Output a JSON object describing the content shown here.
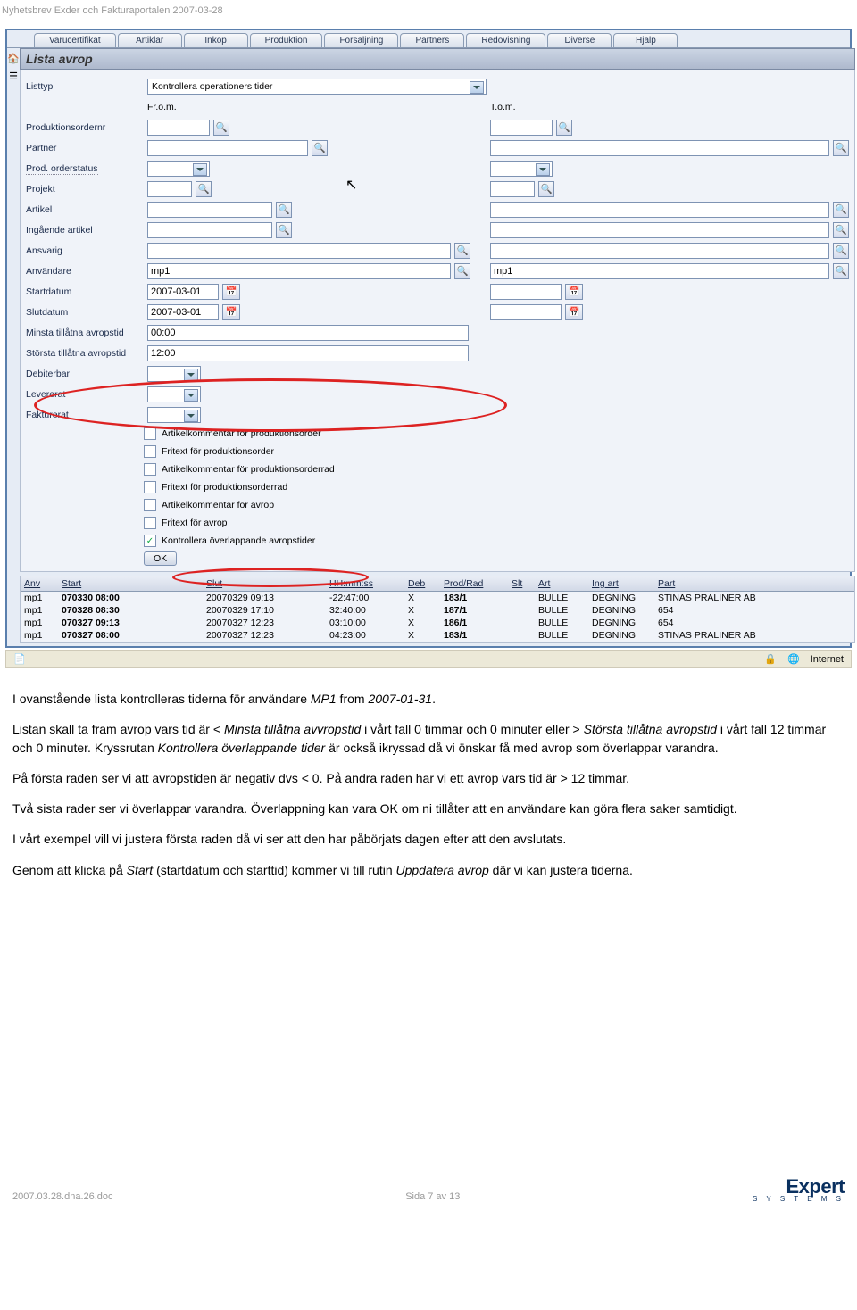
{
  "page_header": "Nyhetsbrev Exder och Fakturaportalen 2007-03-28",
  "menu": [
    "Varucertifikat",
    "Artiklar",
    "Inköp",
    "Produktion",
    "Försäljning",
    "Partners",
    "Redovisning",
    "Diverse",
    "Hjälp"
  ],
  "panel_title": "Lista avrop",
  "labels": {
    "listtyp": "Listtyp",
    "from": "Fr.o.m.",
    "tom": "T.o.m.",
    "podnr": "Produktionsordernr",
    "partner": "Partner",
    "status": "Prod. orderstatus",
    "projekt": "Projekt",
    "artikel": "Artikel",
    "ingart": "Ingående artikel",
    "ansvarig": "Ansvarig",
    "anvandare": "Användare",
    "startdatum": "Startdatum",
    "slutdatum": "Slutdatum",
    "mintid": "Minsta tillåtna avropstid",
    "maxtid": "Största tillåtna avropstid",
    "debiterbar": "Debiterbar",
    "levererat": "Levererat",
    "fakturerat": "Fakturerat"
  },
  "values": {
    "listtyp": "Kontrollera operationers tider",
    "anv_from": "mp1",
    "anv_to": "mp1",
    "startdatum": "2007-03-01",
    "slutdatum": "2007-03-01",
    "mintid": "00:00",
    "maxtid": "12:00"
  },
  "checkboxes": [
    {
      "label": "Artikelkommentar för produktionsorder",
      "checked": false
    },
    {
      "label": "Fritext för produktionsorder",
      "checked": false
    },
    {
      "label": "Artikelkommentar för produktionsorderrad",
      "checked": false
    },
    {
      "label": "Fritext för produktionsorderrad",
      "checked": false
    },
    {
      "label": "Artikelkommentar för avrop",
      "checked": false
    },
    {
      "label": "Fritext för avrop",
      "checked": false
    },
    {
      "label": "Kontrollera överlappande avropstider",
      "checked": true
    }
  ],
  "ok_label": "OK",
  "table": {
    "headers": {
      "anv": "Anv",
      "start": "Start",
      "slut": "Slut",
      "hms": "HH:mm:ss",
      "deb": "Deb",
      "prad": "Prod/Rad",
      "slt": "Slt",
      "art": "Art",
      "ing": "Ing art",
      "part": "Part"
    },
    "rows": [
      {
        "anv": "mp1",
        "start": "070330 08:00",
        "slut": "20070329 09:13",
        "hms": "-22:47:00",
        "deb": "X",
        "prad": "183/1",
        "slt": "",
        "art": "BULLE",
        "ing": "DEGNING",
        "part": "STINAS PRALINER AB"
      },
      {
        "anv": "mp1",
        "start": "070328 08:30",
        "slut": "20070329 17:10",
        "hms": "32:40:00",
        "deb": "X",
        "prad": "187/1",
        "slt": "",
        "art": "BULLE",
        "ing": "DEGNING",
        "part": "654"
      },
      {
        "anv": "mp1",
        "start": "070327 09:13",
        "slut": "20070327 12:23",
        "hms": "03:10:00",
        "deb": "X",
        "prad": "186/1",
        "slt": "",
        "art": "BULLE",
        "ing": "DEGNING",
        "part": "654"
      },
      {
        "anv": "mp1",
        "start": "070327 08:00",
        "slut": "20070327 12:23",
        "hms": "04:23:00",
        "deb": "X",
        "prad": "183/1",
        "slt": "",
        "art": "BULLE",
        "ing": "DEGNING",
        "part": "STINAS PRALINER AB"
      }
    ]
  },
  "status": {
    "zone": "Internet"
  },
  "paragraphs": {
    "p1a": "I ovanstående lista kontrolleras tiderna för användare ",
    "p1b": "MP1",
    "p1c": " from ",
    "p1d": "2007-01-31",
    "p1e": ".",
    "p2a": "Listan skall ta fram avrop vars tid är < ",
    "p2b": "Minsta tillåtna avvropstid",
    "p2c": " i vårt fall 0 timmar och 0 minuter eller > ",
    "p2d": "Största tillåtna avropstid",
    "p2e": " i vårt fall 12 timmar och 0 minuter. Kryssrutan ",
    "p2f": "Kontrollera överlappande tider",
    "p2g": " är också ikryssad då vi önskar få med avrop som överlappar varandra.",
    "p3": "På första raden ser vi att avropstiden är negativ dvs < 0. På andra raden har vi ett avrop vars tid är > 12 timmar.",
    "p4": "Två sista rader ser vi överlappar varandra. Överlappning kan vara OK om ni tillåter att en användare kan göra flera saker samtidigt.",
    "p5": "I vårt exempel vill vi justera första raden då vi ser att den har påbörjats dagen efter att den avslutats.",
    "p6a": "Genom att klicka på ",
    "p6b": "Start",
    "p6c": " (startdatum och starttid) kommer vi till rutin ",
    "p6d": "Uppdatera avrop",
    "p6e": " där vi kan justera tiderna."
  },
  "footer": {
    "file": "2007.03.28.dna.26.doc",
    "page": "Sida 7 av 13",
    "brand": "Expert",
    "brand_sub": "S Y S T E M S"
  }
}
